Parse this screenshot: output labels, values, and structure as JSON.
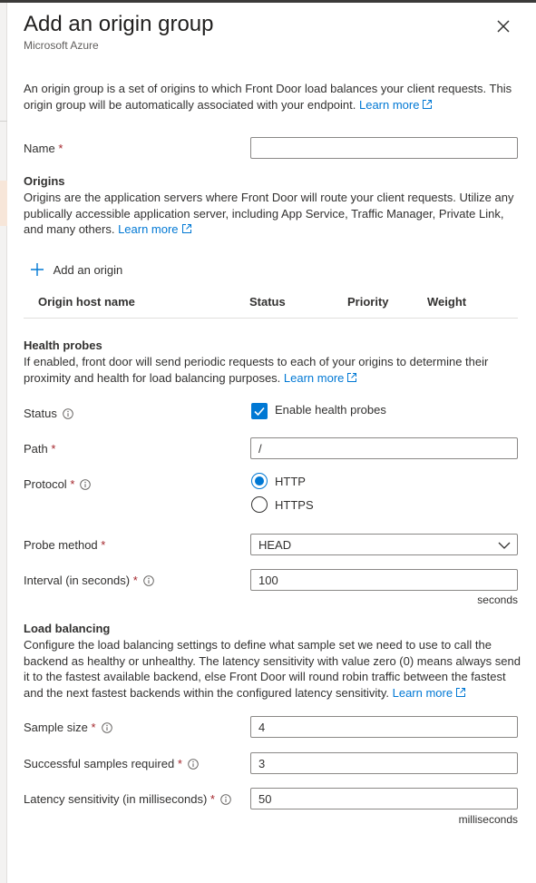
{
  "header": {
    "title": "Add an origin group",
    "subtitle": "Microsoft Azure"
  },
  "intro": {
    "text": "An origin group is a set of origins to which Front Door load balances your client requests. This origin group will be automatically associated with your endpoint. ",
    "link": "Learn more"
  },
  "name_field": {
    "label": "Name",
    "required": "*",
    "value": ""
  },
  "origins": {
    "heading": "Origins",
    "description": "Origins are the application servers where Front Door will route your client requests. Utilize any publically accessible application server, including App Service, Traffic Manager, Private Link, and many others. ",
    "link": "Learn more",
    "add_label": "Add an origin",
    "columns": [
      "Origin host name",
      "Status",
      "Priority",
      "Weight"
    ]
  },
  "health_probes": {
    "heading": "Health probes",
    "description": "If enabled, front door will send periodic requests to each of your origins to determine their proximity and health for load balancing purposes. ",
    "link": "Learn more",
    "status_label": "Status",
    "checkbox_label": "Enable health probes",
    "checkbox_checked": true,
    "path_label": "Path",
    "path_value": "/",
    "protocol_label": "Protocol",
    "protocol_options": [
      "HTTP",
      "HTTPS"
    ],
    "protocol_selected": "HTTP",
    "probe_method_label": "Probe method",
    "probe_method_value": "HEAD",
    "interval_label": "Interval (in seconds)",
    "interval_value": "100",
    "interval_unit": "seconds"
  },
  "load_balancing": {
    "heading": "Load balancing",
    "description": "Configure the load balancing settings to define what sample set we need to use to call the backend as healthy or unhealthy. The latency sensitivity with value zero (0) means always send it to the fastest available backend, else Front Door will round robin traffic between the fastest and the next fastest backends within the configured latency sensitivity. ",
    "link": "Learn more",
    "sample_size_label": "Sample size",
    "sample_size_value": "4",
    "successful_samples_label": "Successful samples required",
    "successful_samples_value": "3",
    "latency_label": "Latency sensitivity (in milliseconds)",
    "latency_value": "50",
    "latency_unit": "milliseconds"
  },
  "colors": {
    "accent": "#0078d4",
    "required": "#a4262c",
    "text": "#323130",
    "border": "#8a8886"
  },
  "icons": [
    "close-icon",
    "external-link-icon",
    "plus-icon",
    "info-icon",
    "checkmark-icon",
    "chevron-down-icon"
  ]
}
